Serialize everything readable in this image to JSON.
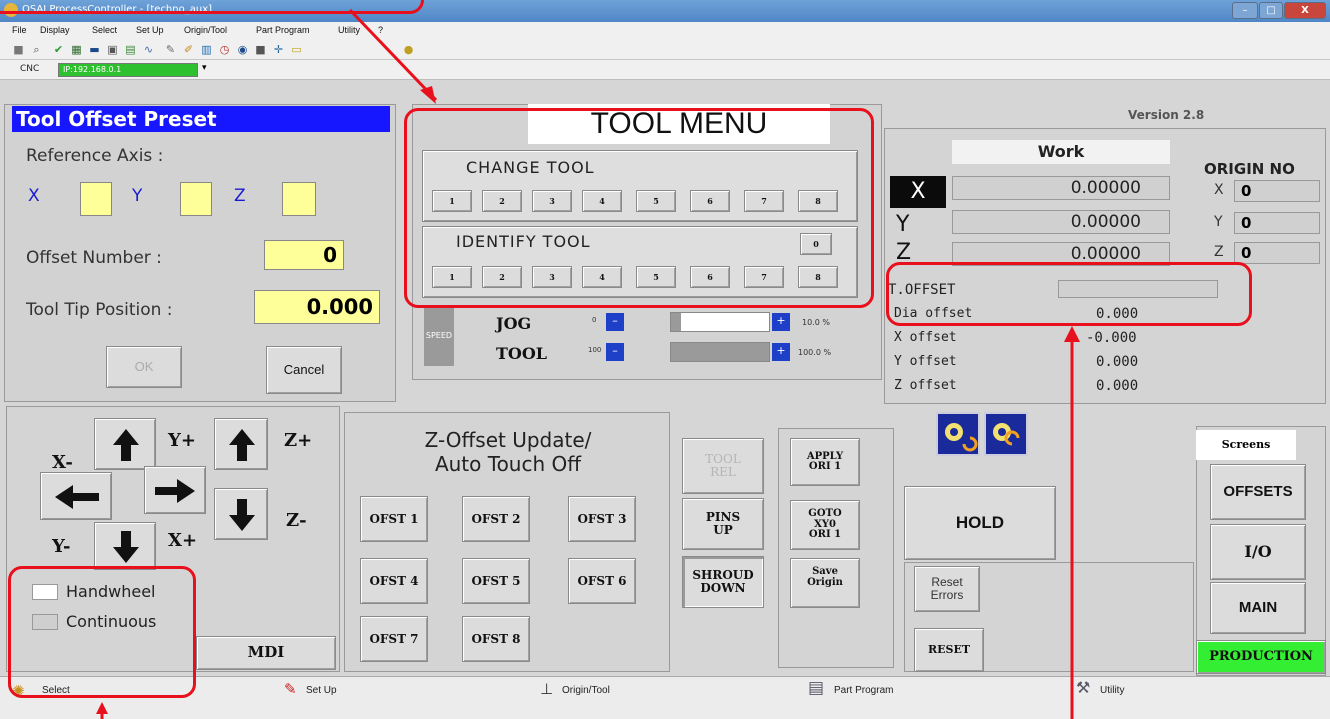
{
  "window": {
    "title": "OSAI ProcessController - [techno_aux]",
    "min": "–",
    "max": "□",
    "close": "X"
  },
  "menu": [
    "File",
    "Display",
    "Select",
    "Set Up",
    "Origin/Tool",
    "Part Program",
    "Utility",
    "?"
  ],
  "cnc": {
    "label": "CNC",
    "address": "IP:192.168.0.1"
  },
  "preset": {
    "title": "Tool Offset Preset",
    "reference_axis": "Reference Axis  :",
    "x": "X",
    "y": "Y",
    "z": "Z",
    "offset_number_label": "Offset Number  :",
    "offset_number": "0",
    "tool_tip_label": "Tool Tip Position :",
    "tool_tip_value": "0.000",
    "ok": "OK",
    "cancel": "Cancel"
  },
  "tool_menu": {
    "title": "TOOL MENU",
    "change_label": "CHANGE TOOL",
    "identify_label": "IDENTIFY TOOL",
    "identify_zero": "0",
    "buttons": [
      "1",
      "2",
      "3",
      "4",
      "5",
      "6",
      "7",
      "8"
    ]
  },
  "override": {
    "speed": "SPEED",
    "jog": "JOG",
    "jog_mark": "0",
    "jog_pct": "10.0 %",
    "jog_fraction": 0.1,
    "tool": "TOOL",
    "tool_mark": "100",
    "tool_pct": "100.0 %",
    "tool_fraction": 1.0,
    "minus": "–",
    "plus": "+"
  },
  "position": {
    "version": "Version 2.8",
    "work_label": "Work",
    "origin_no": "ORIGIN NO",
    "axes": [
      {
        "name": "X",
        "value": "0.00000",
        "origin": "0"
      },
      {
        "name": "Y",
        "value": "0.00000",
        "origin": "0"
      },
      {
        "name": "Z",
        "value": "0.00000",
        "origin": "0"
      }
    ],
    "t_offset": "T.OFFSET",
    "offsets": [
      {
        "label": "Dia offset",
        "value": "0.000"
      },
      {
        "label": "X offset",
        "value": "-0.000"
      },
      {
        "label": "Y offset",
        "value": "0.000"
      },
      {
        "label": "Z offset",
        "value": "0.000"
      }
    ]
  },
  "jog": {
    "x_minus": "X-",
    "y_plus": "Y+",
    "z_plus": "Z+",
    "y_minus": "Y-",
    "x_plus": "X+",
    "z_minus": "Z-",
    "handwheel": "Handwheel",
    "continuous": "Continuous",
    "mdi": "MDI"
  },
  "zoffset": {
    "title_line1": "Z-Offset Update/",
    "title_line2": "Auto Touch Off",
    "buttons": [
      "OFST 1",
      "OFST 2",
      "OFST 3",
      "OFST 4",
      "OFST 5",
      "OFST 6",
      "OFST 7",
      "OFST 8"
    ]
  },
  "aux": {
    "tool_rel": "TOOL\nREL",
    "pins_up": "PINS\nUP",
    "shroud_down": "SHROUD\nDOWN",
    "apply_ori": "APPLY\nORI 1",
    "goto": "GOTO\nXY0\nORI 1",
    "save_origin": "Save\nOrigin"
  },
  "control": {
    "hold": "HOLD",
    "reset_errors": "Reset\nErrors",
    "reset": "RESET"
  },
  "screens": {
    "title": "Screens",
    "offsets": "OFFSETS",
    "io": "I/O",
    "main": "MAIN",
    "production": "PRODUCTION"
  },
  "bottom": [
    "Select",
    "Set Up",
    "Origin/Tool",
    "Part Program",
    "Utility"
  ],
  "colors": {
    "accent_red": "#e8101c",
    "title_blue": "#1a1aff",
    "input_yellow": "#ffff99",
    "production_green": "#33ee33",
    "override_blue": "#1e3fc8"
  }
}
